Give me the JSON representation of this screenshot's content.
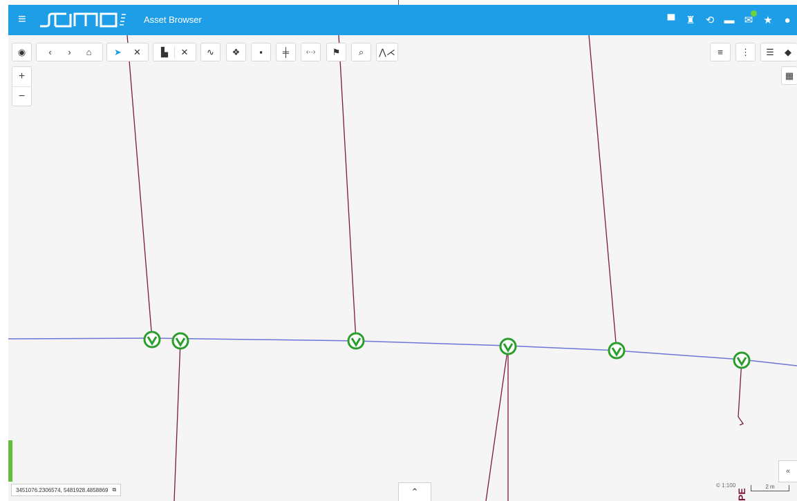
{
  "app": {
    "logo": "samo",
    "title": "Asset Browser"
  },
  "header_icons": [
    "chat-icon",
    "cart-icon",
    "history-icon",
    "print-icon",
    "mail-icon",
    "star-icon",
    "account-icon"
  ],
  "toolbar": {
    "tools": [
      "locate-icon",
      "back-icon",
      "forward-icon",
      "home-icon",
      "select-arrow-icon",
      "clear-selection-icon",
      "stamp-icon",
      "clear-stamp-icon",
      "draw-icon",
      "add-object-icon",
      "delete-icon",
      "split-icon",
      "measure-distance-icon",
      "flag-icon",
      "zoom-icon",
      "line-profile-icon"
    ],
    "right_tools": [
      "list-icon",
      "more-icon",
      "legend-icon",
      "layers-icon",
      "grid-icon"
    ]
  },
  "zoom": {
    "in": "+",
    "out": "−"
  },
  "footer": {
    "coordinates": "3451076.2306574, 5481928.4858869",
    "scale": "1:100",
    "scalebar_label": "2 m",
    "map_label": "PE"
  },
  "colors": {
    "appbar": "#1e9ee6",
    "main_line": "#6b76d8",
    "branch_line": "#7a1a3a",
    "valve": "#2a9d2a"
  }
}
